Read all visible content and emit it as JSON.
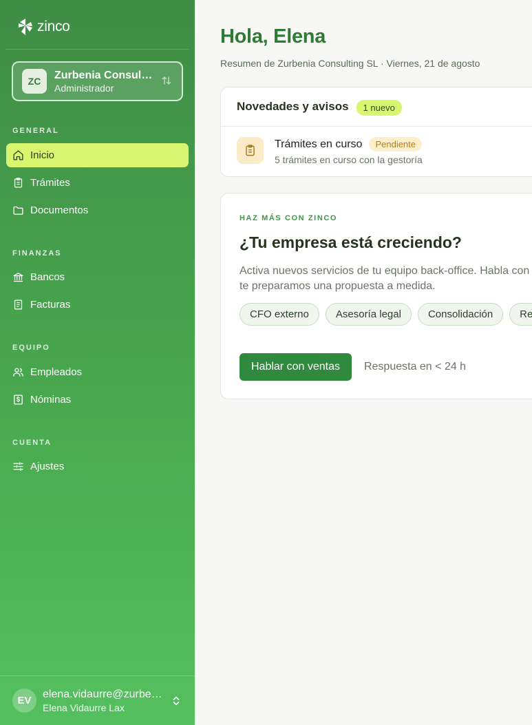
{
  "brand": {
    "logo_text": "zinco"
  },
  "company": {
    "initials": "ZC",
    "name": "Zurbenia Consulting SL",
    "role": "Administrador"
  },
  "sidebar": {
    "sections": [
      {
        "label": "GENERAL",
        "items": [
          {
            "label": "Inicio",
            "icon": "home-icon",
            "active": true
          },
          {
            "label": "Trámites",
            "icon": "clipboard-icon"
          },
          {
            "label": "Documentos",
            "icon": "folder-icon"
          }
        ]
      },
      {
        "label": "FINANZAS",
        "items": [
          {
            "label": "Bancos",
            "icon": "bank-icon"
          },
          {
            "label": "Facturas",
            "icon": "invoice-icon"
          }
        ]
      },
      {
        "label": "EQUIPO",
        "items": [
          {
            "label": "Empleados",
            "icon": "users-icon"
          },
          {
            "label": "Nóminas",
            "icon": "payroll-icon"
          }
        ]
      },
      {
        "label": "CUENTA",
        "items": [
          {
            "label": "Ajustes",
            "icon": "sliders-icon"
          }
        ]
      }
    ]
  },
  "user": {
    "initials": "EV",
    "email": "elena.vidaurre@zurbenia.com",
    "name": "Elena Vidaurre Lax"
  },
  "header": {
    "greeting": "Hola, Elena",
    "subtitle": "Resumen de Zurbenia Consulting SL · Viernes, 21 de agosto"
  },
  "news": {
    "title": "Novedades y avisos",
    "badge": "1 nuevo",
    "items": [
      {
        "title": "Trámites en curso",
        "status": "Pendiente",
        "description": "5 trámites en curso con la gestoría",
        "icon": "clipboard-icon"
      }
    ]
  },
  "promo": {
    "eyebrow": "HAZ MÁS CON ZINCO",
    "title": "¿Tu empresa está creciendo?",
    "description": "Activa nuevos servicios de tu equipo back-office. Habla con ventas y te preparamos una propuesta a medida.",
    "chips": [
      "CFO externo",
      "Asesoría legal",
      "Consolidación",
      "Reporting"
    ],
    "cta_label": "Hablar con ventas",
    "response_note": "Respuesta en < 24 h"
  },
  "colors": {
    "accent": "#2f8a3e",
    "highlight": "#d8f56f",
    "pending": "#b17f17"
  }
}
